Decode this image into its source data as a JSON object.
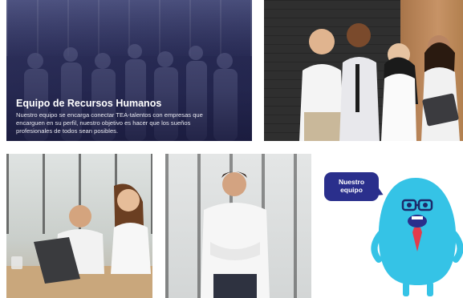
{
  "hero": {
    "title": "Equipo de Recursos Humanos",
    "description": "Nuestro equipo se encarga conectar TEA-talentos con empresas que encarguen en su perfil, nuestro objetivo es hacer que los sueños profesionales de todos sean posibles."
  },
  "mascot": {
    "bubble_text_line1": "Nuestro",
    "bubble_text_line2": "equipo"
  },
  "colors": {
    "hero_overlay": "#2c2f5a",
    "bubble": "#2a2f8c",
    "mascot_body": "#35c3e6",
    "mascot_tie": "#e23c4c"
  }
}
